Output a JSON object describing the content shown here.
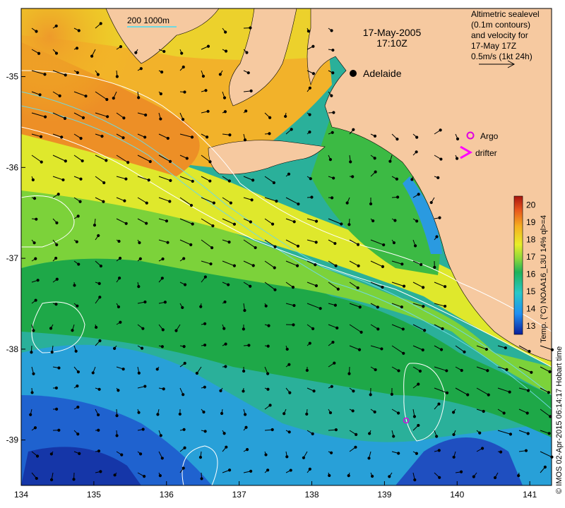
{
  "map": {
    "title_date": "17-May-2005",
    "title_time": "17:10Z",
    "legend_lines": [
      "Altimetric sealevel",
      "(0.1m contours)",
      "and velocity for",
      "17-May 17Z",
      "0.5m/s (1kt 24h)"
    ],
    "depth_contours_label": "200  1000m",
    "city_label": "Adelaide",
    "argo_label": "Argo",
    "drifter_label": "drifter",
    "colorbar_label": "Temp. (°C) NOAA16_L3U 14% ql>=4",
    "colorbar_ticks": [
      "20",
      "19",
      "18",
      "17",
      "16",
      "15",
      "14",
      "13"
    ],
    "colorbar_range": [
      12.5,
      20.5
    ],
    "x_ticks": [
      "134",
      "135",
      "136",
      "137",
      "138",
      "139",
      "140",
      "141"
    ],
    "y_ticks": [
      "-35",
      "-36",
      "-37",
      "-38",
      "-39"
    ],
    "x_range": [
      134,
      141.3
    ],
    "y_range": [
      -39.5,
      -34.25
    ],
    "credit": "© IMOS 02-Apr-2015 06:14:17 Hobart time",
    "colors": {
      "land": "#f6c9a0",
      "argo": "#e000e0",
      "drifter": "#ff00ff",
      "contour_white": "#ffffff",
      "contour_cyan": "#6fd8e0"
    }
  }
}
